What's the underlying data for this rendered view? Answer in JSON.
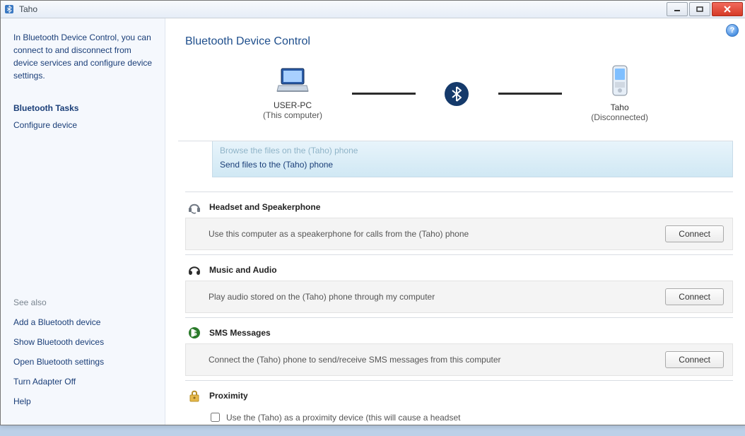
{
  "window": {
    "title": "Taho"
  },
  "sidebar": {
    "intro": "In Bluetooth Device Control, you can connect to and disconnect from device services and configure device settings.",
    "tasks_heading": "Bluetooth Tasks",
    "tasks": [
      {
        "label": "Configure device"
      }
    ],
    "seealso_heading": "See also",
    "seealso": [
      {
        "label": "Add a Bluetooth device"
      },
      {
        "label": "Show Bluetooth devices"
      },
      {
        "label": "Open Bluetooth settings"
      },
      {
        "label": "Turn Adapter Off"
      },
      {
        "label": "Help"
      }
    ]
  },
  "main": {
    "title": "Bluetooth Device Control",
    "diagram": {
      "left_name": "USER-PC",
      "left_sub": "(This computer)",
      "right_name": "Taho",
      "right_sub": "(Disconnected)"
    },
    "file_transfer": {
      "cut_label": "Browse the files on the (Taho) phone",
      "send_label": "Send files to the (Taho) phone"
    },
    "sections": {
      "headset": {
        "title": "Headset and Speakerphone",
        "desc": "Use this computer as a speakerphone for calls from the (Taho) phone",
        "button": "Connect"
      },
      "music": {
        "title": "Music and Audio",
        "desc": "Play audio stored on the (Taho) phone through my computer",
        "button": "Connect"
      },
      "sms": {
        "title": "SMS Messages",
        "desc": "Connect the (Taho) phone to send/receive SMS messages from this computer",
        "button": "Connect"
      },
      "proximity": {
        "title": "Proximity",
        "checkbox_label": "Use the (Taho) as a proximity device (this will cause a headset"
      }
    }
  }
}
